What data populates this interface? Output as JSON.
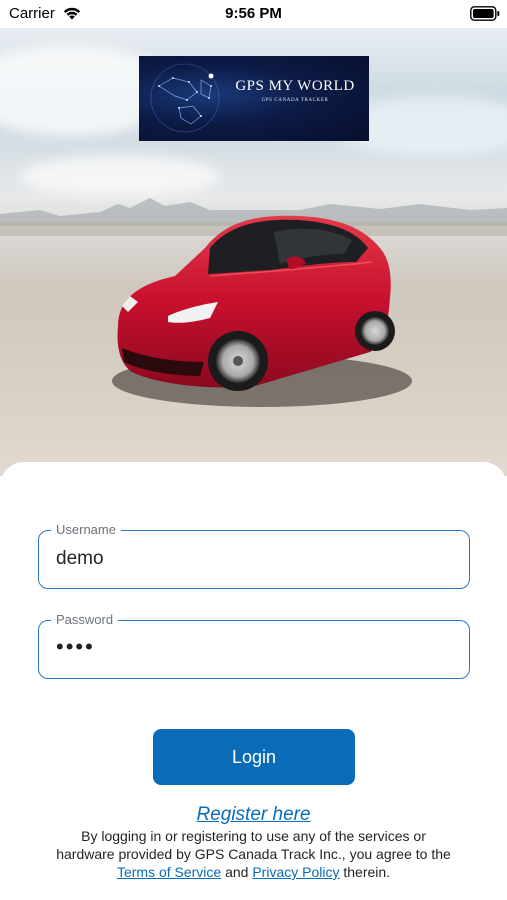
{
  "status_bar": {
    "carrier": "Carrier",
    "time": "9:56 PM"
  },
  "logo": {
    "title": "GPS MY WORLD",
    "subtitle": "GPS CANADA TRACKER"
  },
  "form": {
    "username": {
      "label": "Username",
      "value": "demo"
    },
    "password": {
      "label": "Password",
      "value": "••••"
    },
    "login_label": "Login"
  },
  "register_label": "Register here",
  "disclaimer": {
    "line1": "By logging in or registering to use any of the services or",
    "line2": "hardware provided by GPS Canada Track Inc., you agree to the",
    "terms_label": "Terms of Service",
    "and_text": " and ",
    "privacy_label": "Privacy Policy",
    "suffix": " therein."
  },
  "colors": {
    "accent": "#0a6bb8",
    "field_border": "#2b79c2",
    "car": "#c8102e",
    "logo_bg": "#0c1a45"
  },
  "icons": {
    "wifi": "wifi-icon",
    "battery": "battery-icon"
  }
}
